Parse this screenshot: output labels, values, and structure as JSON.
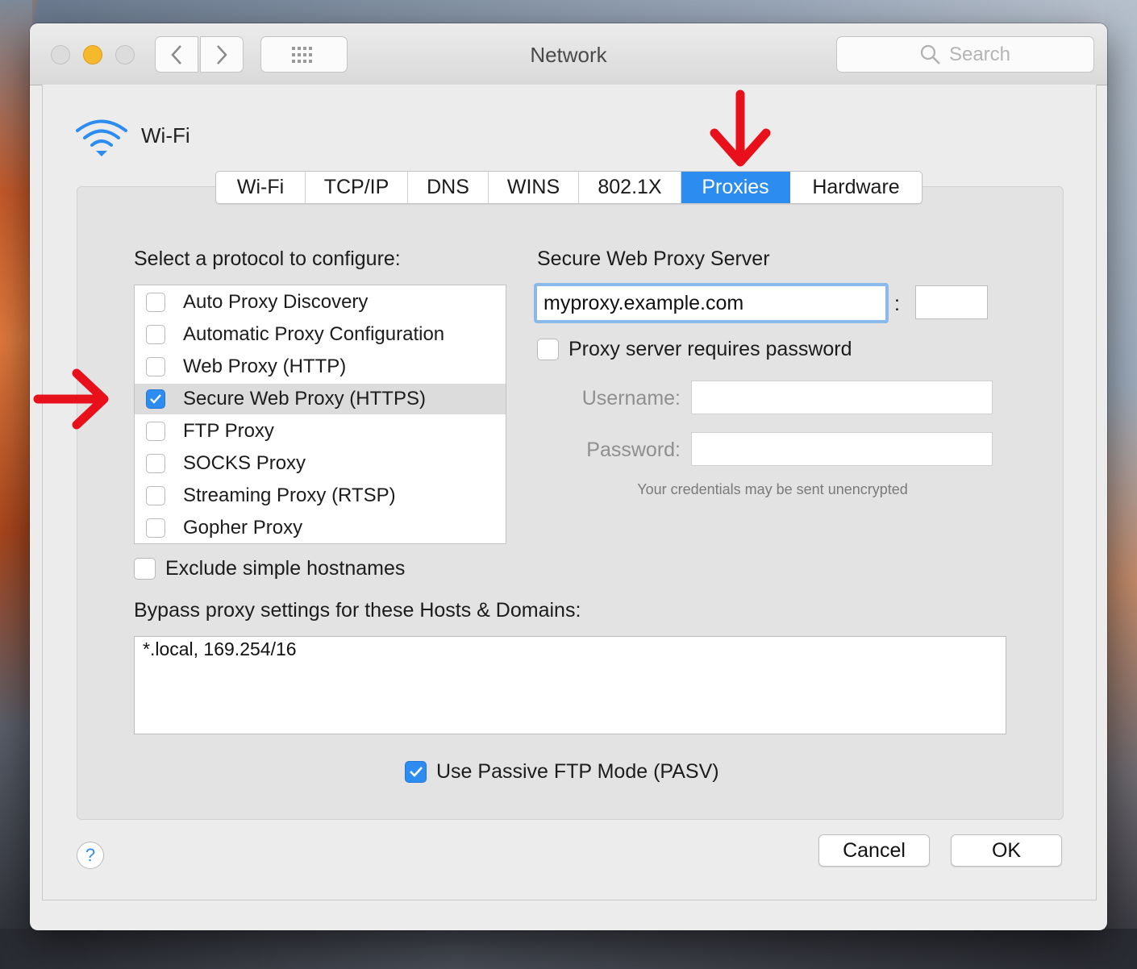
{
  "window": {
    "title": "Network"
  },
  "search": {
    "placeholder": "Search"
  },
  "interface": {
    "name": "Wi-Fi"
  },
  "tabs": [
    {
      "label": "Wi-Fi",
      "active": false
    },
    {
      "label": "TCP/IP",
      "active": false
    },
    {
      "label": "DNS",
      "active": false
    },
    {
      "label": "WINS",
      "active": false
    },
    {
      "label": "802.1X",
      "active": false
    },
    {
      "label": "Proxies",
      "active": true
    },
    {
      "label": "Hardware",
      "active": false
    }
  ],
  "protocols": {
    "heading": "Select a protocol to configure:",
    "items": [
      {
        "label": "Auto Proxy Discovery",
        "checked": false
      },
      {
        "label": "Automatic Proxy Configuration",
        "checked": false
      },
      {
        "label": "Web Proxy (HTTP)",
        "checked": false
      },
      {
        "label": "Secure Web Proxy (HTTPS)",
        "checked": true,
        "selected": true
      },
      {
        "label": "FTP Proxy",
        "checked": false
      },
      {
        "label": "SOCKS Proxy",
        "checked": false
      },
      {
        "label": "Streaming Proxy (RTSP)",
        "checked": false
      },
      {
        "label": "Gopher Proxy",
        "checked": false
      }
    ]
  },
  "server": {
    "heading": "Secure Web Proxy Server",
    "host": "myproxy.example.com",
    "colon": ":",
    "port": "",
    "requires_password_label": "Proxy server requires password",
    "requires_password": false,
    "username_label": "Username:",
    "password_label": "Password:",
    "username": "",
    "password": "",
    "note": "Your credentials may be sent unencrypted"
  },
  "exclude_simple": {
    "label": "Exclude simple hostnames",
    "checked": false
  },
  "bypass": {
    "heading": "Bypass proxy settings for these Hosts & Domains:",
    "value": "*.local, 169.254/16"
  },
  "passive_ftp": {
    "label": "Use Passive FTP Mode (PASV)",
    "checked": true
  },
  "buttons": {
    "help": "?",
    "cancel": "Cancel",
    "ok": "OK"
  },
  "colors": {
    "accent": "#2d8cf0",
    "annotation_arrow": "#e8101a",
    "minimize": "#f7b92c"
  }
}
